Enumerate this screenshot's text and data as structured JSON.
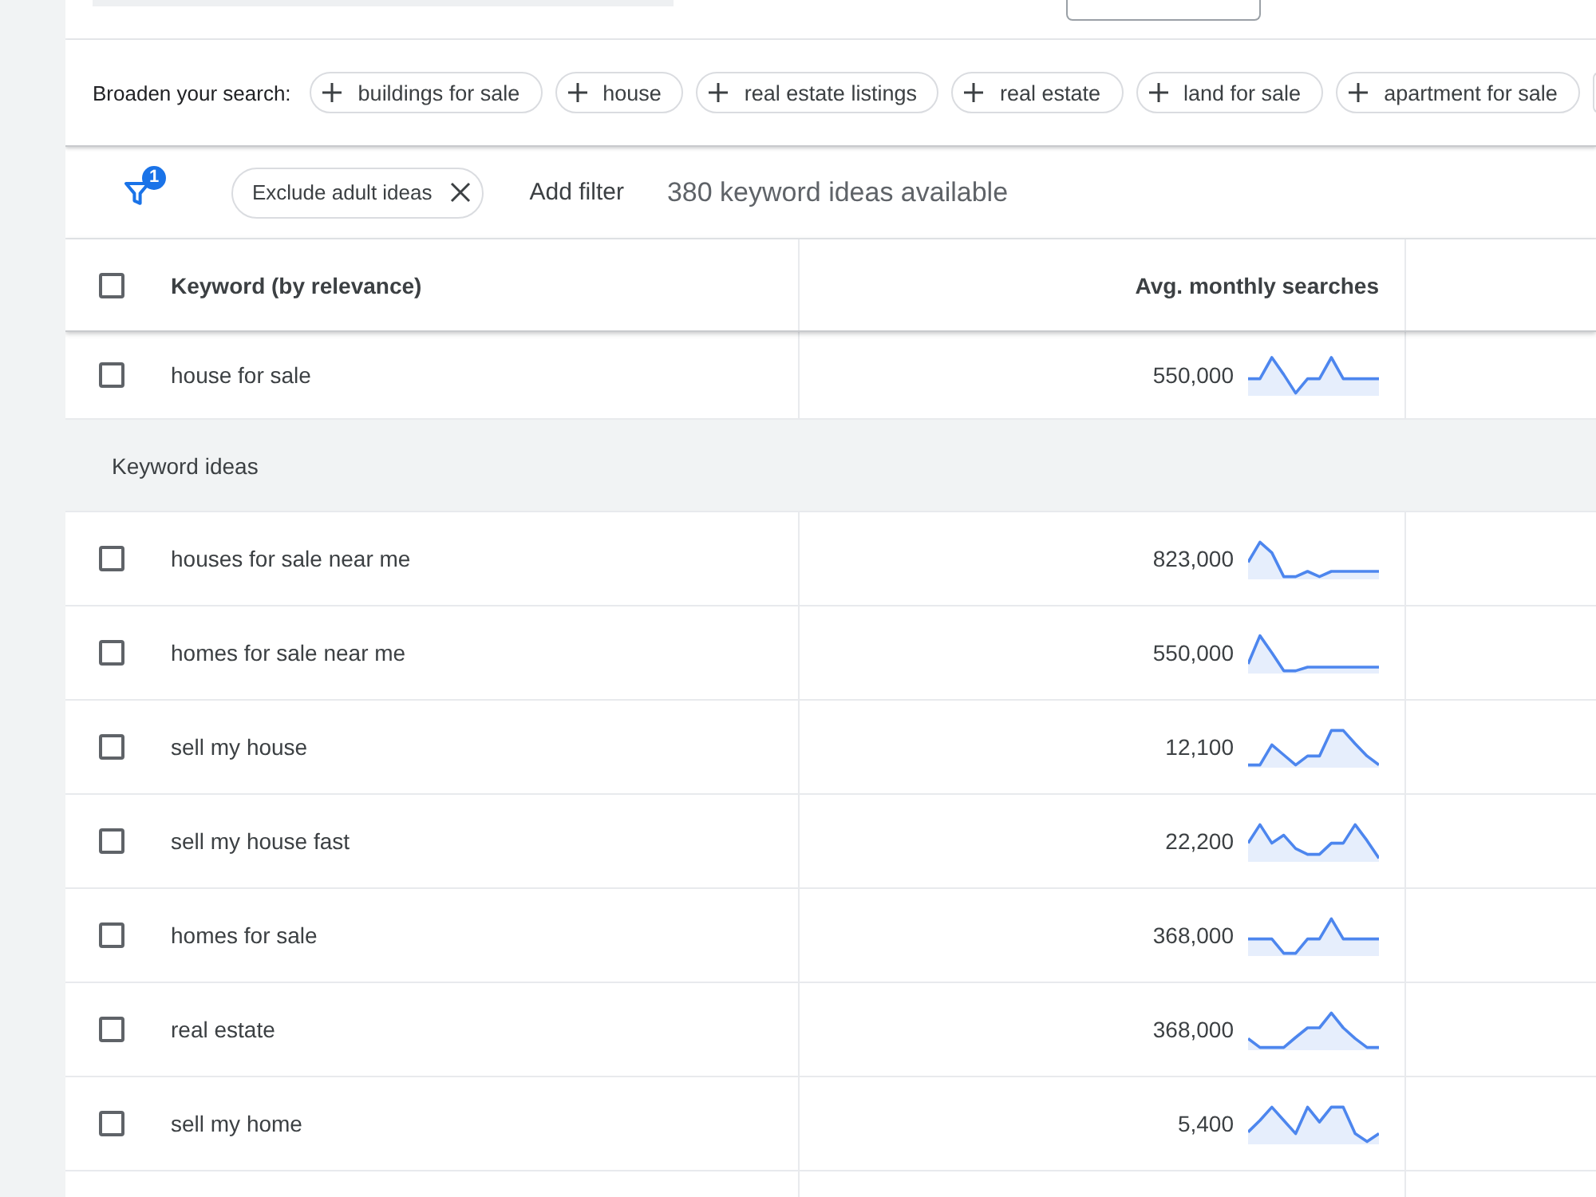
{
  "broaden_search": {
    "label": "Broaden your search:",
    "chips": [
      "buildings for sale",
      "house",
      "real estate listings",
      "real estate",
      "land for sale",
      "apartment for sale"
    ]
  },
  "filters": {
    "badge": "1",
    "chips": [
      "Exclude adult ideas"
    ],
    "add_filter": "Add filter",
    "summary": "380 keyword ideas available"
  },
  "table": {
    "select_all": {
      "checked": false
    },
    "columns": [
      "Keyword (by relevance)",
      "Avg. monthly searches"
    ],
    "provided_keywords": [
      {
        "keyword": "house for sale",
        "searches": "550,000",
        "checked": false
      }
    ],
    "ideas_heading": "Keyword ideas",
    "keyword_ideas": [
      {
        "keyword": "houses for sale near me",
        "searches": "823,000",
        "checked": false
      },
      {
        "keyword": "homes for sale near me",
        "searches": "550,000",
        "checked": false
      },
      {
        "keyword": "sell my house",
        "searches": "12,100",
        "checked": false
      },
      {
        "keyword": "sell my house fast",
        "searches": "22,200",
        "checked": false
      },
      {
        "keyword": "homes for sale",
        "searches": "368,000",
        "checked": false
      },
      {
        "keyword": "real estate",
        "searches": "368,000",
        "checked": false
      },
      {
        "keyword": "sell my home",
        "searches": "5,400",
        "checked": false
      }
    ]
  }
}
